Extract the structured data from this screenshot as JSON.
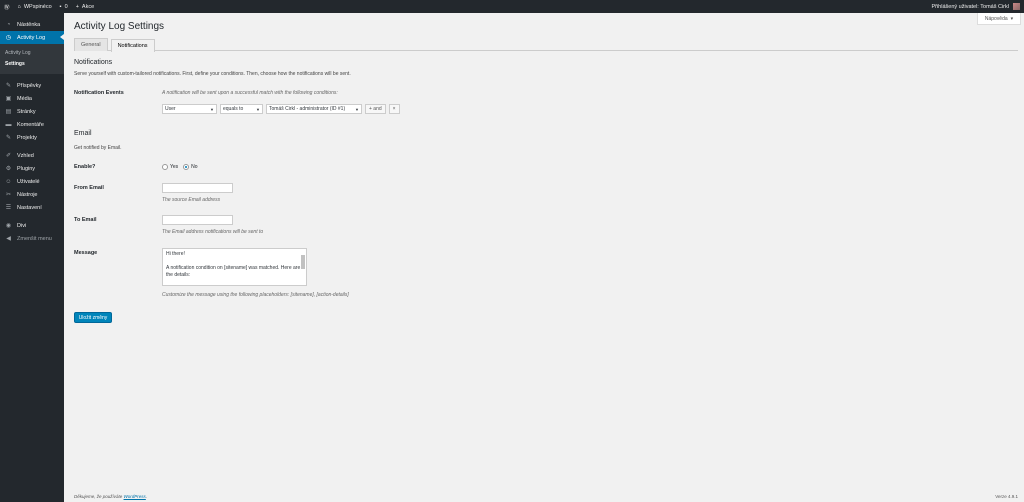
{
  "adminbar": {
    "site": "WPspinéco",
    "comments": "0",
    "new": "Akce",
    "greeting": "Přihlášený uživatel: Tomáš Cirkl"
  },
  "sidebar": {
    "items": [
      {
        "icon": "dashboard-icon",
        "label": "Nástěnka"
      },
      {
        "icon": "activity-log-icon",
        "label": "Activity Log"
      },
      {
        "icon": "pin-icon",
        "label": "Příspěvky"
      },
      {
        "icon": "media-icon",
        "label": "Média"
      },
      {
        "icon": "pages-icon",
        "label": "Stránky"
      },
      {
        "icon": "comments-icon",
        "label": "Komentáře"
      },
      {
        "icon": "pin-icon",
        "label": "Projekty"
      },
      {
        "icon": "appearance-icon",
        "label": "Vzhled"
      },
      {
        "icon": "plugins-icon",
        "label": "Pluginy"
      },
      {
        "icon": "users-icon",
        "label": "Uživatelé"
      },
      {
        "icon": "tools-icon",
        "label": "Nástroje"
      },
      {
        "icon": "settings-icon",
        "label": "Nastavení"
      },
      {
        "icon": "divi-icon",
        "label": "Divi"
      },
      {
        "icon": "collapse-icon",
        "label": "Zmenšit menu"
      }
    ],
    "submenu": [
      "Activity Log",
      "Settings"
    ]
  },
  "header": {
    "help": "Nápověda",
    "title": "Activity Log Settings",
    "tabs": [
      "General",
      "Notifications"
    ]
  },
  "notifications": {
    "heading": "Notifications",
    "intro": "Serve yourself with custom-tailored notifications. First, define your conditions. Then, choose how the notifications will be sent.",
    "events_label": "Notification Events",
    "events_hint": "A notification will be sent upon a successful match with the following conditions:",
    "cond_field": "User",
    "cond_op": "equals to",
    "cond_value": "Tomáš Cirkl - administrator (ID #1)",
    "and_btn": "+ and",
    "remove_btn": "×"
  },
  "email": {
    "heading": "Email",
    "intro": "Get notified by Email.",
    "enable_label": "Enable?",
    "yes": "Yes",
    "no": "No",
    "selected": "No",
    "from_label": "From Email",
    "from_hint": "The source Email address",
    "from_value": "",
    "to_label": "To Email",
    "to_hint": "The Email address notifications will be sent to",
    "to_value": "",
    "message_label": "Message",
    "message": "Hi there!\n\nA notification condition on [sitename] was matched. Here are the details:",
    "message_hint": "Customize the message using the following placeholders: [sitename], [action-details]"
  },
  "save": "Uložit změny",
  "footer": {
    "thanks": "Děkujeme, že používáte",
    "wp": "WordPress",
    "version": "Verze 4.9.1"
  }
}
